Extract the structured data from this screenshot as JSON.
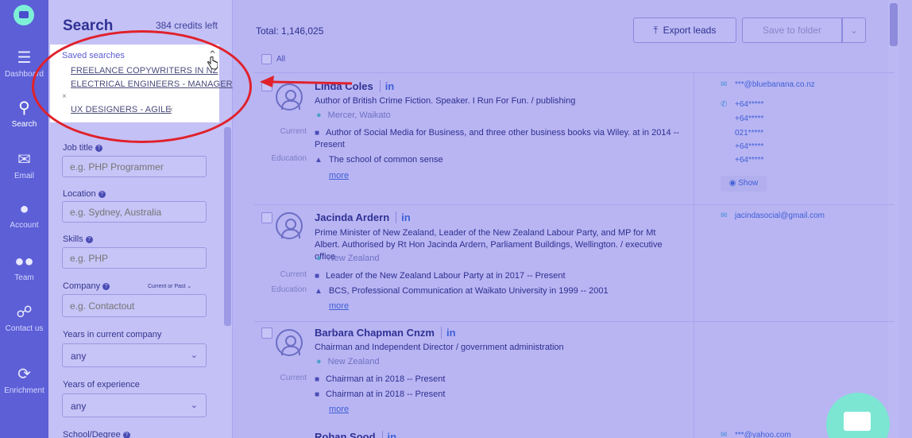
{
  "rail": {
    "items": [
      {
        "label": "Dashboard",
        "icon": "database-icon"
      },
      {
        "label": "Search",
        "icon": "search-icon"
      },
      {
        "label": "Email",
        "icon": "envelope-icon"
      },
      {
        "label": "Account",
        "icon": "user-icon"
      },
      {
        "label": "Team",
        "icon": "users-icon"
      },
      {
        "label": "Contact us",
        "icon": "handshake-icon"
      },
      {
        "label": "Enrichment",
        "icon": "refresh-icon"
      }
    ]
  },
  "panel": {
    "title": "Search",
    "credits": "384 credits left",
    "saved": {
      "title": "Saved searches",
      "items": [
        "FREELANCE COPYWRITERS IN NZ",
        "ELECTRICAL ENGINEERS - MANAGER",
        "UX DESIGNERS - AGILE"
      ],
      "remove": "×"
    },
    "fields": {
      "job_title": {
        "label": "Job title",
        "placeholder": "e.g. PHP Programmer"
      },
      "location": {
        "label": "Location",
        "placeholder": "e.g. Sydney, Australia"
      },
      "skills": {
        "label": "Skills",
        "placeholder": "e.g. PHP"
      },
      "company": {
        "label": "Company",
        "qualifier": "Current or Past",
        "placeholder": "e.g. Contactout"
      },
      "years_company": {
        "label": "Years in current company",
        "value": "any"
      },
      "years_experience": {
        "label": "Years of experience",
        "value": "any"
      },
      "school": {
        "label": "School/Degree"
      }
    }
  },
  "main": {
    "total": "Total: 1,146,025",
    "export_label": "Export leads",
    "save_label": "Save to folder",
    "all_label": "All",
    "more_label": "more",
    "show_label": "Show",
    "tags": {
      "current": "Current",
      "education": "Education"
    },
    "results": [
      {
        "name": "Linda Coles",
        "li": "in",
        "headline": "Author of British Crime Fiction. Speaker. I Run For Fun. / publishing",
        "location": "Mercer, Waikato",
        "current": "Author of Social Media for Business, and three other business books via Wiley. at in 2014 -- Present",
        "education": "The school of common sense",
        "email": "***@bluebanana.co.nz",
        "phones": [
          "+64*****",
          "+64*****",
          "021*****",
          "+64*****",
          "+64*****"
        ]
      },
      {
        "name": "Jacinda Ardern",
        "li": "in",
        "headline": "Prime Minister of New Zealand, Leader of the New Zealand Labour Party, and MP for Mt Albert. Authorised by Rt Hon Jacinda Ardern, Parliament Buildings, Wellington. / executive office",
        "location": "New Zealand",
        "current": "Leader of the New Zealand Labour Party at in 2017 -- Present",
        "education": "BCS, Professional Communication at Waikato University in 1999 -- 2001",
        "email": "jacindasocial@gmail.com"
      },
      {
        "name": "Barbara Chapman Cnzm",
        "li": "in",
        "headline": "Chairman and Independent Director / government administration",
        "location": "New Zealand",
        "current": "Chairman at in 2018 -- Present",
        "current2": "Chairman at in 2018 -- Present"
      },
      {
        "name": "Rohan Sood",
        "li": "in",
        "email": "***@yahoo.com"
      }
    ]
  }
}
